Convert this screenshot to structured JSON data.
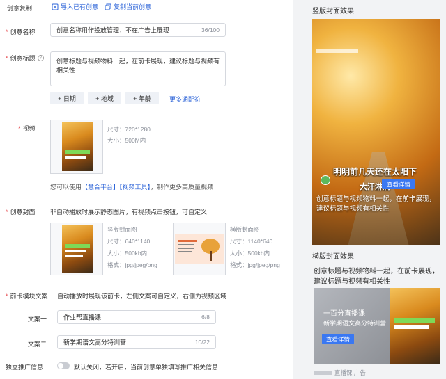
{
  "header": {
    "label": "创意复制",
    "import_label": "导入已有创意",
    "copy_label": "复制当前创意"
  },
  "name_field": {
    "label": "创意名称",
    "value": "创意名称用作投放管理，不在广告上展现",
    "count": "36/100"
  },
  "title_field": {
    "label": "创意标题",
    "value_line1": "创意标题与视频物料一起，在前卡展现，建议标题与视频有",
    "value_line2": "相关性",
    "buttons": [
      "+ 日期",
      "+ 地域",
      "+ 年龄"
    ],
    "more_link": "更多通配符"
  },
  "video": {
    "label": "视频",
    "size": "尺寸：720*1280",
    "filesize": "大小：500M内",
    "hint_prefix": "您可以使用",
    "platform_link": "【慧合平台】",
    "tool_link": "【视频工具】",
    "hint_suffix": "，制作更多高质量视频"
  },
  "cover": {
    "label": "创意封面",
    "desc": "非自动播放时展示静态图片，有视频点击按钮，可自定义",
    "vertical": {
      "title": "竖版封面图",
      "size": "尺寸：640*1140",
      "filesize": "大小：500kb内",
      "format": "格式：jpg/jpeg/png"
    },
    "horizontal": {
      "title": "横版封面图",
      "size": "尺寸：1140*640",
      "filesize": "大小：500kb内",
      "format": "格式：jpg/jpeg/png"
    }
  },
  "front_card": {
    "label": "前卡模块文案",
    "desc": "自动播放时展现该前卡，左侧文案可自定义，右侧为视频区域",
    "copy1": {
      "label": "文案一",
      "value": "作业帮直播课",
      "count": "6/8"
    },
    "copy2": {
      "label": "文案二",
      "value": "新学期语文高分特训营",
      "count": "10/22"
    }
  },
  "independent": {
    "label": "独立推广信息",
    "desc": "默认关闭，若开启，当前创意单独填写推广相关信息"
  },
  "preview": {
    "vertical_title": "竖版封面效果",
    "overlay_line1": "明明前几天还在太阳下",
    "overlay_line2": "大汗淋漓",
    "view_btn": "查看详情",
    "caption_line1": "创意标题与视频物料一起，在前卡展现，",
    "caption_line2": "建议标题与视频有相关性",
    "horizontal_title": "横版封面效果",
    "h_caption_line1": "创意标题与视频物料一起，在前卡展现，",
    "h_caption_line2": "建议标题与视频有相关性",
    "card_line1": "一百分直播课",
    "card_line2": "新学期语文高分特训营",
    "card_btn": "查看详情",
    "footer_text": "直播课 广告"
  },
  "colors": {
    "link": "#2d64d8",
    "required": "#e5484d",
    "preview_btn": "#3a78f2"
  }
}
